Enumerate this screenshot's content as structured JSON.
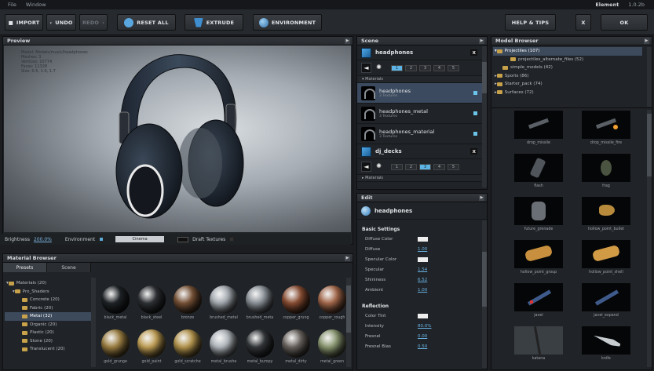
{
  "menu": {
    "file": "File",
    "window": "Window",
    "app": "Element",
    "version": "1.0.2b"
  },
  "toolbar": {
    "import": "IMPORT",
    "undo": "UNDO",
    "redo": "REDO",
    "reset_all": "RESET ALL",
    "extrude": "EXTRUDE",
    "environment": "ENVIRONMENT",
    "help": "HELP & TIPS",
    "close": "X",
    "ok": "OK"
  },
  "preview": {
    "title": "Preview",
    "info": [
      "Model: Models/music/headphones",
      "Meshes: 3",
      "Vertices: 10774",
      "Faces: 11328",
      "Size: 0.5, 1.0, 1.7"
    ]
  },
  "viewbar": {
    "brightness_label": "Brightness",
    "brightness_value": "200.0%",
    "environment_label": "Environment",
    "env_select": "Cinema",
    "draft_label": "Draft Textures"
  },
  "material_browser": {
    "title": "Material Browser",
    "tab_presets": "Presets",
    "tab_scene": "Scene",
    "tree": [
      "Materials (20)",
      "Pro_Shaders",
      "Concrete (20)",
      "Fabric (20)",
      "Metal (32)",
      "Organic (20)",
      "Plastic (20)",
      "Stone (20)",
      "Translucent (20)"
    ],
    "materials": [
      {
        "name": "black_metal",
        "color": "#202428"
      },
      {
        "name": "black_steel",
        "color": "#2f3236"
      },
      {
        "name": "bronze",
        "color": "#7a5438"
      },
      {
        "name": "brushed_metal",
        "color": "#a7adb4"
      },
      {
        "name": "brushed_meta",
        "color": "#8d949b"
      },
      {
        "name": "copper_grung",
        "color": "#8c4f34"
      },
      {
        "name": "copper_rough",
        "color": "#a76a4c"
      },
      {
        "name": "gold_grunge",
        "color": "#a08244"
      },
      {
        "name": "gold_paint",
        "color": "#c4a257"
      },
      {
        "name": "gold_scratche",
        "color": "#b8984f"
      },
      {
        "name": "metal_brushe",
        "color": "#b4bac0"
      },
      {
        "name": "metal_bumpy",
        "color": "#34373b"
      },
      {
        "name": "metal_dirty",
        "color": "#6b6560"
      },
      {
        "name": "metal_green",
        "color": "#8c9a73"
      }
    ]
  },
  "scene": {
    "title": "Scene",
    "object1": "headphones",
    "materials_label": "Materials",
    "materials": [
      {
        "name": "headphones",
        "sub": "3 Textures"
      },
      {
        "name": "headphones_metal",
        "sub": "3 Textures"
      },
      {
        "name": "headphones_material",
        "sub": "3 Textures"
      }
    ],
    "object2": "dj_decks",
    "nums": [
      "1",
      "2",
      "3",
      "4",
      "5"
    ]
  },
  "edit": {
    "title": "Edit",
    "object": "headphones",
    "basic_title": "Basic Settings",
    "basic": [
      {
        "label": "Diffuse Color",
        "value": ""
      },
      {
        "label": "Diffuse",
        "value": "1.00"
      },
      {
        "label": "Specular Color",
        "value": ""
      },
      {
        "label": "Specular",
        "value": "1.54"
      },
      {
        "label": "Shininess",
        "value": "6.52"
      },
      {
        "label": "Ambient",
        "value": "1.00"
      }
    ],
    "reflection_title": "Reflection",
    "reflection": [
      {
        "label": "Color Tint",
        "value": ""
      },
      {
        "label": "Intensity",
        "value": "80.0%"
      },
      {
        "label": "Fresnel",
        "value": "0.00"
      },
      {
        "label": "Fresnel Bias",
        "value": "0.50"
      }
    ]
  },
  "model_browser": {
    "title": "Model Browser",
    "tree": [
      "Projectiles (107)",
      "projectiles_alternate_files (52)",
      "simple_models (42)",
      "Sports (86)",
      "Starter_pack (74)",
      "Surfaces (72)"
    ],
    "models": [
      "drop_missile",
      "drop_missile_fire",
      "flash",
      "frag",
      "future_grenade",
      "hollow_point_bullet",
      "hollow_point_group",
      "hollow_point_shell",
      "javel",
      "javel_expand",
      "katana",
      "knife"
    ]
  }
}
